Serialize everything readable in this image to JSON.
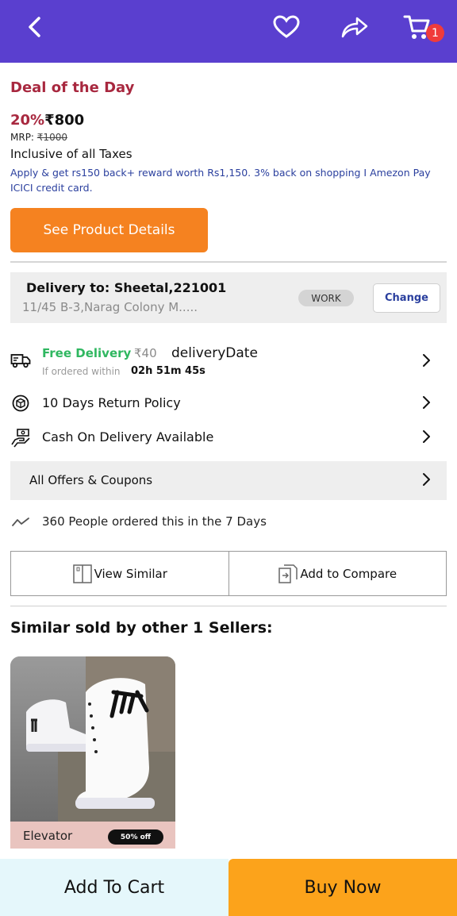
{
  "header": {
    "cart_count": "1",
    "icons": [
      "back-arrow-icon",
      "heart-icon",
      "share-icon",
      "cart-icon"
    ]
  },
  "deal": {
    "label": "Deal of the Day",
    "discount": "20%",
    "price": "₹800",
    "mrp_label": "MRP: ",
    "mrp_value": "₹1000",
    "taxes": "Inclusive of all Taxes",
    "offer_text": "Apply & get rs150 back+ reward worth Rs1,150. 3% back on shopping I Amezon Pay ICICI credit card."
  },
  "details_button": "See Product Details",
  "delivery": {
    "title": "Delivery to: Sheetal,221001",
    "address": "11/45 B-3,Narag Colony M.....",
    "tag": "WORK",
    "change_label": "Change"
  },
  "shipping": {
    "free_delivery": "Free Delivery",
    "fee": "₹40",
    "date_label": "deliveryDate",
    "if_ordered": "If ordered within",
    "countdown": "02h 51m 45s"
  },
  "policies": {
    "return_policy": "10 Days Return Policy",
    "cod": "Cash On Delivery Available"
  },
  "offers_label": "All Offers & Coupons",
  "people_ordered": "360 People ordered this in the 7 Days",
  "actions": {
    "view_similar": "View Similar",
    "add_compare": "Add to Compare"
  },
  "similar": {
    "title": "Similar sold by other 1 Sellers:",
    "items": [
      {
        "name": "Elevator",
        "badge": "50% off"
      }
    ]
  },
  "bottom": {
    "add_to_cart": "Add To Cart",
    "buy_now": "Buy Now"
  },
  "colors": {
    "header": "#5a3fcf",
    "accent_orange": "#f58220",
    "buy_now": "#fca31b",
    "deal_red": "#a8283f",
    "free_green": "#2fb760",
    "link_blue": "#2a3f9e"
  }
}
